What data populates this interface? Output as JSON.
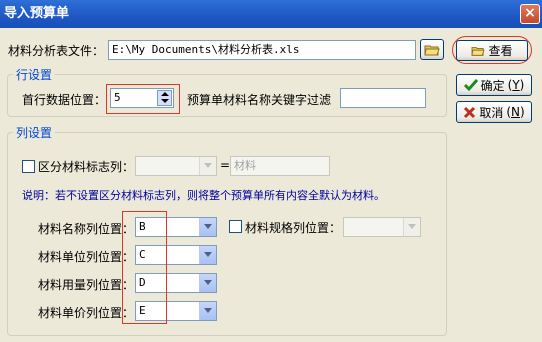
{
  "window": {
    "title": "导入预算单",
    "close_label": "×"
  },
  "file": {
    "label": "材料分析表文件：",
    "path": "E:\\My Documents\\材料分析表.xls"
  },
  "buttons": {
    "view": "查看",
    "ok": "确定",
    "ok_key": "Y",
    "cancel": "取消",
    "cancel_key": "N"
  },
  "row_settings": {
    "title": "行设置",
    "first_row_label": "首行数据位置：",
    "first_row_value": "5",
    "keyword_filter_label": "预算单材料名称关键字过滤",
    "keyword_filter_value": ""
  },
  "col_settings": {
    "title": "列设置",
    "distinguish_label": "区分材料标志列：",
    "distinguish_value": "",
    "equals": "=",
    "material_placeholder": "材料",
    "note": "说明：若不设置区分材料标志列，则将整个预算单所有内容全默认为材料。",
    "name_col_label": "材料名称列位置：",
    "name_col_value": "B",
    "spec_col_label": "材料规格列位置：",
    "spec_col_value": "",
    "unit_col_label": "材料单位列位置：",
    "unit_col_value": "C",
    "qty_col_label": "材料用量列位置：",
    "qty_col_value": "D",
    "price_col_label": "材料单价列位置：",
    "price_col_value": "E"
  },
  "colors": {
    "title_bar": "#1e57c4",
    "group_title": "#0046d5",
    "note": "#0000a0",
    "highlight": "#d9382b",
    "window_bg": "#ece9d8"
  },
  "icons": {
    "folder": "folder-icon",
    "check": "check-icon",
    "cancel": "cancel-icon",
    "close": "close-icon"
  }
}
